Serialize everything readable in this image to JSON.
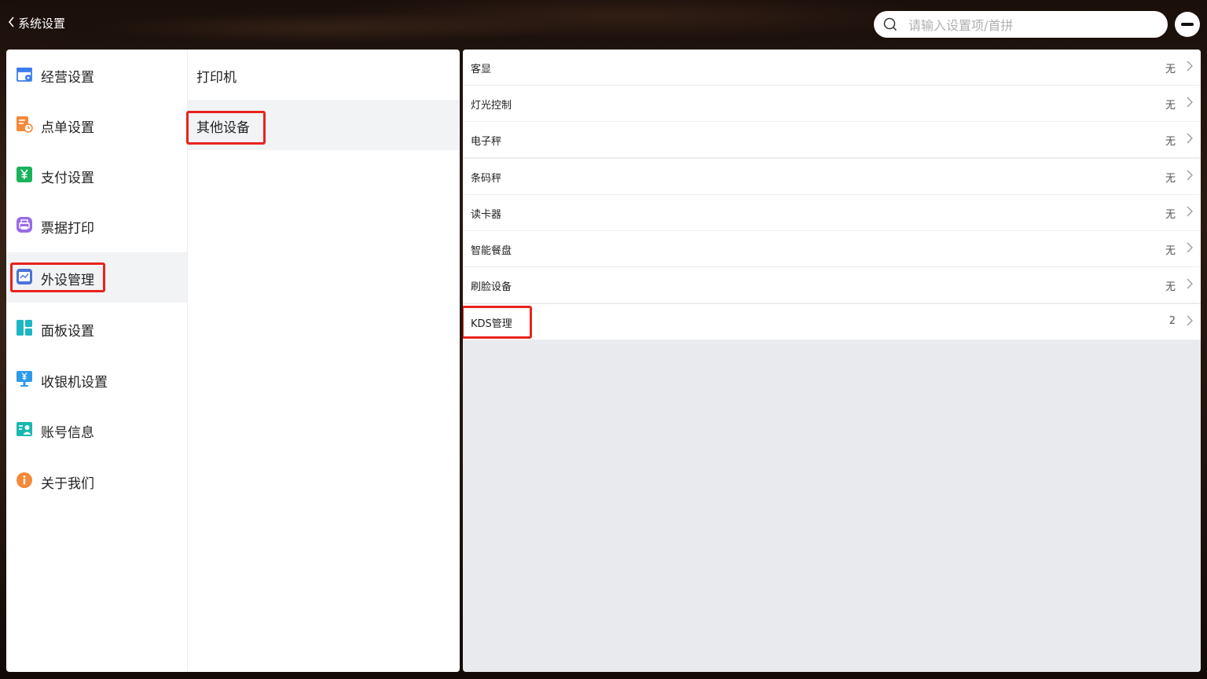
{
  "header": {
    "back_label": "系统设置",
    "search_placeholder": "请输入设置项/首拼"
  },
  "nav": {
    "items": [
      {
        "label": "经营设置",
        "icon": "store-settings-icon",
        "color": "#3b7cf0"
      },
      {
        "label": "点单设置",
        "icon": "order-settings-icon",
        "color": "#f5893a"
      },
      {
        "label": "支付设置",
        "icon": "payment-yen-icon",
        "color": "#19b35a"
      },
      {
        "label": "票据打印",
        "icon": "printer-icon",
        "color": "#9b6ce6"
      },
      {
        "label": "外设管理",
        "icon": "peripheral-icon",
        "color": "#4b74d8"
      },
      {
        "label": "面板设置",
        "icon": "panel-layout-icon",
        "color": "#1fb6c4"
      },
      {
        "label": "收银机设置",
        "icon": "cashier-monitor-icon",
        "color": "#2b9be8"
      },
      {
        "label": "账号信息",
        "icon": "account-icon",
        "color": "#18b8b0"
      },
      {
        "label": "关于我们",
        "icon": "info-icon",
        "color": "#f5893a"
      }
    ],
    "active_index": 4
  },
  "sub": {
    "items": [
      {
        "label": "打印机"
      },
      {
        "label": "其他设备"
      }
    ],
    "active_index": 1
  },
  "devices": {
    "rows": [
      {
        "label": "客显",
        "value": "无"
      },
      {
        "label": "灯光控制",
        "value": "无"
      },
      {
        "label": "电子秤",
        "value": "无"
      },
      {
        "label": "条码秤",
        "value": "无"
      },
      {
        "label": "读卡器",
        "value": "无"
      },
      {
        "label": "智能餐盘",
        "value": "无"
      },
      {
        "label": "刷脸设备",
        "value": "无"
      },
      {
        "label": "KDS管理",
        "value": "2"
      }
    ]
  },
  "colors": {
    "highlight": "#e8231d",
    "active_bg": "#f2f3f5",
    "content_bg": "#e9eaee"
  }
}
